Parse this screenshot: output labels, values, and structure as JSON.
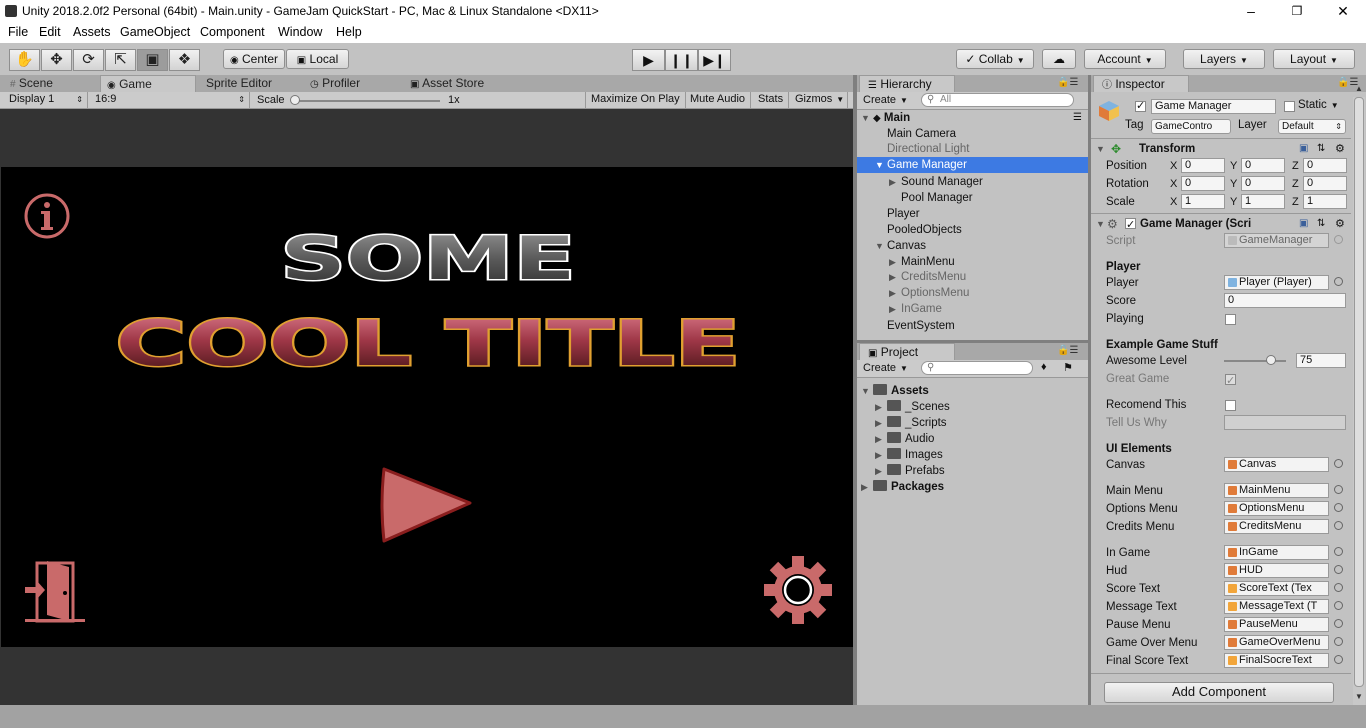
{
  "window": {
    "title": "Unity 2018.2.0f2 Personal (64bit) - Main.unity - GameJam QuickStart - PC, Mac & Linux Standalone <DX11>"
  },
  "menu": [
    "File",
    "Edit",
    "Assets",
    "GameObject",
    "Component",
    "Window",
    "Help"
  ],
  "toolbar": {
    "pivot": "Center",
    "space": "Local",
    "collab": "Collab",
    "account": "Account",
    "layers": "Layers",
    "layout": "Layout"
  },
  "game": {
    "tabs": [
      "Scene",
      "Game",
      "Sprite Editor",
      "Profiler",
      "Asset Store"
    ],
    "display": "Display 1",
    "aspect": "16:9",
    "scale_label": "Scale",
    "scale_value": "1x",
    "maximize": "Maximize On Play",
    "mute": "Mute Audio",
    "stats": "Stats",
    "gizmos": "Gizmos",
    "title_line1": "SOME",
    "title_line2": "COOL TITLE",
    "accent": "#c96a6a"
  },
  "hierarchy": {
    "tab": "Hierarchy",
    "create": "Create",
    "search_placeholder": "All",
    "scene": "Main",
    "rows": [
      {
        "label": "Main Camera"
      },
      {
        "label": "Directional Light"
      },
      {
        "label": "Game Manager"
      },
      {
        "label": "Sound Manager"
      },
      {
        "label": "Pool Manager"
      },
      {
        "label": "Player"
      },
      {
        "label": "PooledObjects"
      },
      {
        "label": "Canvas"
      },
      {
        "label": "MainMenu"
      },
      {
        "label": "CreditsMenu"
      },
      {
        "label": "OptionsMenu"
      },
      {
        "label": "InGame"
      },
      {
        "label": "EventSystem"
      }
    ]
  },
  "project": {
    "tab": "Project",
    "create": "Create",
    "assets": "Assets",
    "folders": [
      "_Scenes",
      "_Scripts",
      "Audio",
      "Images",
      "Prefabs"
    ],
    "packages": "Packages"
  },
  "inspector": {
    "tab": "Inspector",
    "object_name": "Game Manager",
    "static": "Static",
    "tag_label": "Tag",
    "tag_value": "GameContro",
    "layer_label": "Layer",
    "layer_value": "Default",
    "transform": {
      "title": "Transform",
      "position": {
        "label": "Position",
        "x": "0",
        "y": "0",
        "z": "0"
      },
      "rotation": {
        "label": "Rotation",
        "x": "0",
        "y": "0",
        "z": "0"
      },
      "scale": {
        "label": "Scale",
        "x": "1",
        "y": "1",
        "z": "1"
      }
    },
    "component": {
      "title": "Game Manager (Scri",
      "script_label": "Script",
      "script_value": "GameManager",
      "player_section": "Player",
      "player_label": "Player",
      "player_value": "Player (Player)",
      "score_label": "Score",
      "score_value": "0",
      "playing_label": "Playing",
      "example_section": "Example Game Stuff",
      "awesome_label": "Awesome Level",
      "awesome_value": "75",
      "great_label": "Great Game",
      "recomend_label": "Recomend This",
      "tell_label": "Tell Us Why",
      "ui_section": "UI Elements",
      "ui_refs": [
        {
          "label": "Canvas",
          "value": "Canvas"
        },
        {
          "label": "Main Menu",
          "value": "MainMenu"
        },
        {
          "label": "Options Menu",
          "value": "OptionsMenu"
        },
        {
          "label": "Credits Menu",
          "value": "CreditsMenu"
        },
        {
          "label": "In Game",
          "value": "InGame"
        },
        {
          "label": "Hud",
          "value": "HUD"
        },
        {
          "label": "Score Text",
          "value": "ScoreText (Tex"
        },
        {
          "label": "Message Text",
          "value": "MessageText (T"
        },
        {
          "label": "Pause Menu",
          "value": "PauseMenu"
        },
        {
          "label": "Game Over Menu",
          "value": "GameOverMenu"
        },
        {
          "label": "Final Score Text",
          "value": "FinalSocreText"
        }
      ]
    },
    "add_component": "Add Component"
  },
  "axes": {
    "x": "X",
    "y": "Y",
    "z": "Z"
  }
}
